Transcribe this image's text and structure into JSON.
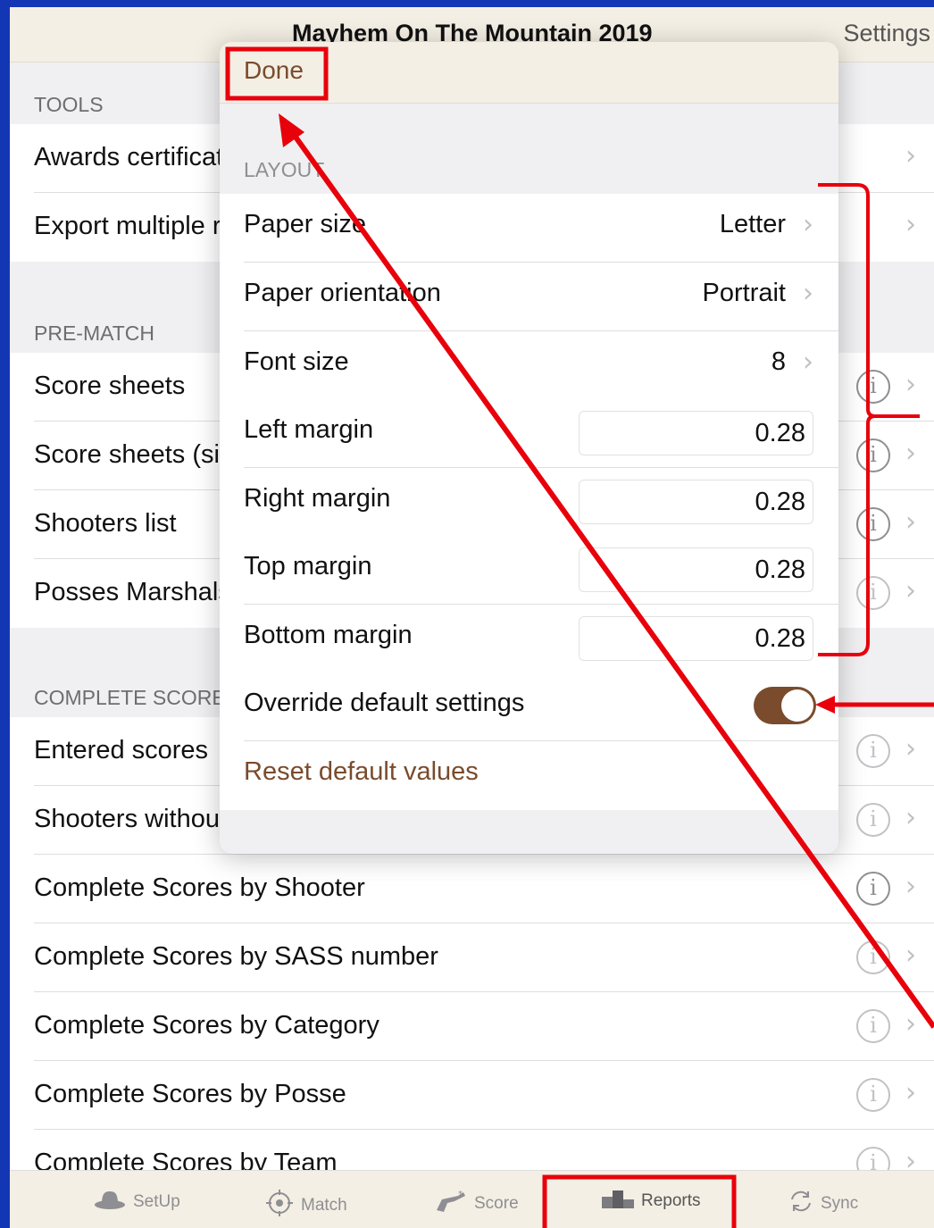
{
  "nav": {
    "title": "Mayhem On The Mountain 2019",
    "settings_label": "Settings"
  },
  "sections": [
    {
      "label": "TOOLS"
    },
    {
      "label": "PRE-MATCH"
    },
    {
      "label": "COMPLETE SCORES"
    }
  ],
  "tools": [
    {
      "label": "Awards certificates"
    },
    {
      "label": "Export multiple reports"
    }
  ],
  "prematch": [
    {
      "label": "Score sheets"
    },
    {
      "label": "Score sheets (single)"
    },
    {
      "label": "Shooters list"
    },
    {
      "label": "Posses Marshals"
    }
  ],
  "complete": [
    {
      "label": "Entered scores"
    },
    {
      "label": "Shooters without scores"
    },
    {
      "label": "Complete Scores by Shooter"
    },
    {
      "label": "Complete Scores by SASS number"
    },
    {
      "label": "Complete Scores by Category"
    },
    {
      "label": "Complete Scores by Posse"
    },
    {
      "label": "Complete Scores by Team"
    }
  ],
  "tabbar": {
    "items": [
      {
        "label": "SetUp",
        "icon": "hat-icon"
      },
      {
        "label": "Match",
        "icon": "target-icon"
      },
      {
        "label": "Score",
        "icon": "revolver-icon"
      },
      {
        "label": "Reports",
        "icon": "podium-icon",
        "selected": true
      },
      {
        "label": "Sync",
        "icon": "sync-icon"
      }
    ]
  },
  "popover": {
    "done_label": "Done",
    "section": "LAYOUT",
    "paper_size": {
      "label": "Paper size",
      "value": "Letter"
    },
    "paper_orientation": {
      "label": "Paper orientation",
      "value": "Portrait"
    },
    "font_size": {
      "label": "Font size",
      "value": "8"
    },
    "left_margin": {
      "label": "Left margin",
      "value": "0.28"
    },
    "right_margin": {
      "label": "Right margin",
      "value": "0.28"
    },
    "top_margin": {
      "label": "Top margin",
      "value": "0.28"
    },
    "bottom_margin": {
      "label": "Bottom margin",
      "value": "0.28"
    },
    "override": {
      "label": "Override default settings",
      "on": true
    },
    "reset_label": "Reset default values"
  },
  "colors": {
    "accent": "#7a4b2c",
    "annotation": "#e8000b",
    "background": "#1336b5",
    "bar": "#f4efe4"
  }
}
